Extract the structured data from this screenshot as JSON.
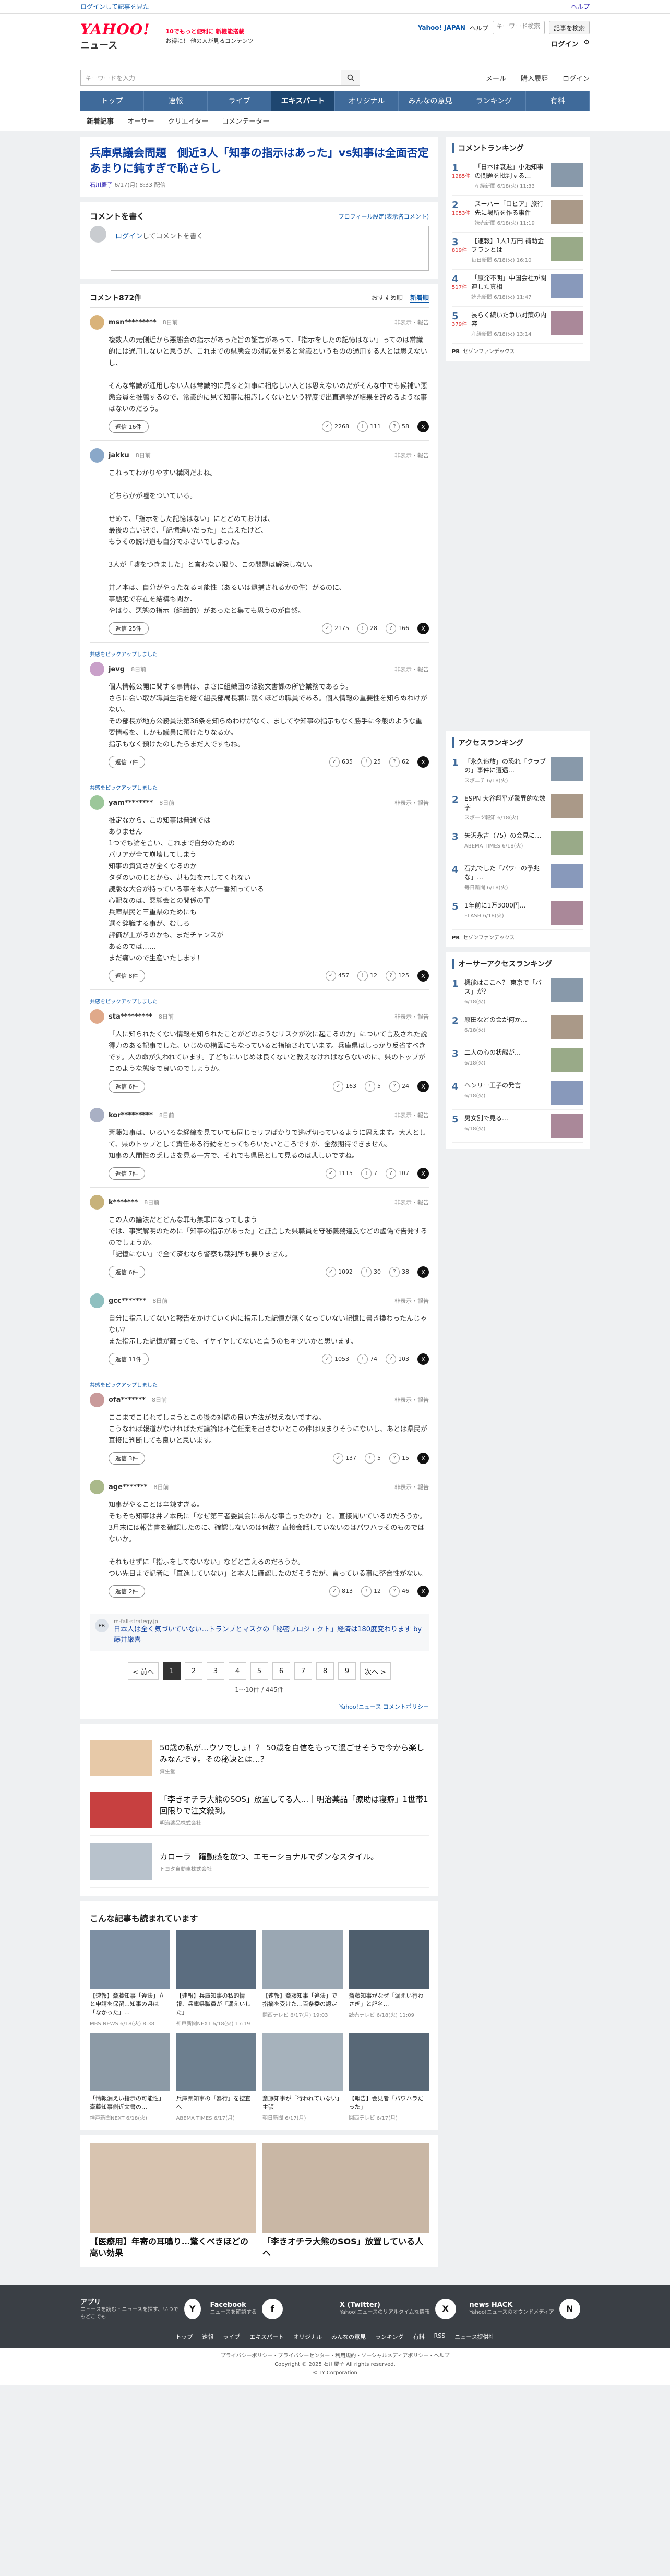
{
  "topstrip": {
    "left": [
      "ログインして記事を見た",
      "Yahoo!JAPAN"
    ],
    "right": [
      "ヘルプ"
    ]
  },
  "header": {
    "logo": "YAHOO!",
    "logo_sub": "ニュース",
    "promo_line1": "10でもっと便利に",
    "promo_line1_accent": "新機能搭載",
    "promo_line2": "お得に！ 他の人が見るコンテンツ",
    "yahoo_japan": "Yahoo! JAPAN",
    "help": "ヘルプ",
    "search_placeholder": "キーワード検索",
    "search_btn": "記事を検索",
    "login": "ログイン",
    "search_main_placeholder": "キーワードを入力",
    "links": [
      "メール",
      "ログイン",
      "購入履歴",
      "ログイン"
    ]
  },
  "nav": {
    "items": [
      "トップ",
      "速報",
      "ライブ",
      "エキスパート",
      "オリジナル",
      "みんなの意見",
      "ランキング",
      "有料"
    ],
    "active_index": 3,
    "sub": [
      "新着記事",
      "オーサー",
      "クリエイター",
      "コメンテーター"
    ],
    "sub_active_index": 0
  },
  "article": {
    "title": "兵庫県議会問題　側近3人「知事の指示はあった」vs知事は全面否定　あまりに鈍すぎで恥さらし",
    "author": "石川慶子",
    "date": "6/17(月) 8:33 配信"
  },
  "comment_form": {
    "title": "コメントを書く",
    "profile_link": "プロフィール設定(表示名コメント)",
    "input_link": "ログイン",
    "input_text": "してコメントを書く"
  },
  "comments_header": {
    "count": "コメント872件",
    "sort": [
      "おすすめ順",
      "新着順"
    ]
  },
  "comments": [
    {
      "pinned": "",
      "name": "msn*********",
      "time": "8日前",
      "report": "非表示・報告",
      "body": "複数人の元側近から悪態会の指示があった旨の証言があって、「指示をしたの記憶はない」ってのは常識的には通用しないと思うが、これまでの県態会の対応を見ると常識というものの通用する人とは思えないし、\n\nそんな常識が通用しない人は常識的に見ると知事に相応しい人とは思えないのだがそんな中でも候補い悪態会員を推薦するので、常識的に見て知事に相応しくないという程度で出直選挙が結果を辞めるような事はないのだろう。",
      "reply": "返信 16件",
      "react": {
        "agree": "2268",
        "cross": "111",
        "think": "58"
      }
    },
    {
      "pinned": "",
      "name": "jakku",
      "time": "8日前",
      "report": "非表示・報告",
      "body": "これってわかりやすい構図だよね。\n\nどちらかが嘘をついている。\n\nせめて、「指示をした記憶はない」にとどめておけば、\n最後の言い訳で、「記憶違いだった」と言えたけど、\nもうその説け道も自分でふさいでしまった。\n\n3人が「嘘をつきました」と言わない限り、この問題は解決しない。\n\n井ノ本は、自分がやったなる可能性（あるいは逮捕されるかの件）がるのに、\n事態犯で存在を結構も聞か、\nやはり、悪態の指示（組織的）があったと集ても思うのが自然。",
      "reply": "返信 25件",
      "react": {
        "agree": "2175",
        "cross": "28",
        "think": "166"
      }
    },
    {
      "pinned": "共感をピックアップしました",
      "name": "jevg",
      "time": "8日前",
      "report": "非表示・報告",
      "body": "個人情報公開に関する事情は、まさに組織団の法務文書課の所管業務であろう。\nさらに会い取が職員生活を経て組長部局長職に就くほどの職員である。個人情報の重要性を知らぬわけがない。\nその部長が地方公務員法第36条を知らぬわけがなく、ましてや知事の指示もなく勝手に今般のような重要情報を、しかも議員に預けたりなるか。\n指示もなく預けたのしたらまだ人ですもね。",
      "reply": "返信 7件",
      "react": {
        "agree": "635",
        "cross": "25",
        "think": "62"
      }
    },
    {
      "pinned": "共感をピックアップしました",
      "name": "yam********",
      "time": "8日前",
      "report": "非表示・報告",
      "body": "推定なから、この知事は普通では\nありません\n1つでも論を言い、これまで自分のための\nバリアが全て崩壊してしまう\n知事の資質さが全くなるのか\nタダのいのじとから、甚も知を示してくれない\n読版な大合が持っている事を本人が一番知っている\n心配なのは、悪態会との関係の罪\n兵庫県民と三重県のためにも\n選ぐ辞職する事が、むしろ\n評価が上がるのかも、まだチャンスが\nあるのでは……\nまだ痛いので生産いたします！",
      "reply": "返信 8件",
      "react": {
        "agree": "457",
        "cross": "12",
        "think": "125"
      }
    },
    {
      "pinned": "共感をピックアップしました",
      "name": "sta*********",
      "time": "8日前",
      "report": "非表示・報告",
      "body": "「人に知られたくない情報を知られたことがどのようなリスクが次に起こるのか」について言及された説得力のある記事でした。いじめの構図にもなっていると指摘されています。兵庫県はしっかり反省すべきです。人の命が失われています。子どもにいじめは良くないと教えなければならないのに、県のトップがこのような態度で良いのでしょうか。",
      "reply": "返信 6件",
      "react": {
        "agree": "163",
        "cross": "5",
        "think": "24"
      }
    },
    {
      "pinned": "",
      "name": "kor*********",
      "time": "8日前",
      "report": "非表示・報告",
      "body": "斎藤知事は、いろいろな経緯を見ていても同じセリフばかりで逃げ切っているように思えます。大人として、県のトップとして責任ある行動をとってもらいたいところですが、全然期待できません。\n知事の人間性の乏しさを見る一方で、それでも県民として見るのは悲しいですね。",
      "reply": "返信 7件",
      "react": {
        "agree": "1115",
        "cross": "7",
        "think": "107"
      }
    },
    {
      "pinned": "",
      "name": "k*******",
      "time": "8日前",
      "report": "非表示・報告",
      "body": "この人の論法だとどんな罪も無罪になってしまう\nでは、事案解明のために「知事の指示があった」と証言した県職員を守秘義務違反などの虚偽で告発するのでしょうか。\n「記憶にない」で全て済むなら警察も裁判所も要りません。",
      "reply": "返信 6件",
      "react": {
        "agree": "1092",
        "cross": "30",
        "think": "38"
      }
    },
    {
      "pinned": "",
      "name": "gcc*******",
      "time": "8日前",
      "report": "非表示・報告",
      "body": "自分に指示してないと報告をかけていく内に指示した記憶が無くなっていない記憶に書き換わったんじゃない？\nまた指示した記憶が蘇っても、イヤイヤしてないと言うのもキツいかと思います。",
      "reply": "返信 11件",
      "react": {
        "agree": "1053",
        "cross": "74",
        "think": "103"
      }
    },
    {
      "pinned": "共感をピックアップしました",
      "name": "ofa*******",
      "time": "8日前",
      "report": "非表示・報告",
      "body": "ここまでこじれてしまうとこの後の対応の良い方法が見えないですね。\nこうなれば報道がなければただ議論は不信任案を出さないとこの件は収まりそうにないし、あとは県民が直接に判断しても良いと思います。",
      "reply": "返信 3件",
      "react": {
        "agree": "137",
        "cross": "5",
        "think": "15"
      }
    },
    {
      "pinned": "",
      "name": "age*******",
      "time": "8日前",
      "report": "非表示・報告",
      "body": "知事がやることは辛辣すぎる。\nそもそも知事は井ノ本氏に「なぜ第三者委員会にあんな事言ったのか」と、直接聞いているのだろうか。3月末には報告書を確認したのに、確認しないのは何故？直接会話していないのはパワハラそのものではないか。\n\nそれもせずに「指示をしてないない」などと言えるのだろうか。\nつい先日まで記者に「直進していない」と本人に確認したのだそうだが、言っている事に整合性がない。",
      "reply": "返信 2件",
      "react": {
        "agree": "813",
        "cross": "12",
        "think": "46"
      }
    }
  ],
  "related_news": {
    "source": "m-fall-strategy.jp",
    "title": "日本人は全く気づいていない…トランプとマスクの「秘密プロジェクト」経済は180度変わります by 藤井厳喜"
  },
  "pager": {
    "prev": "< 前へ",
    "pages": [
      "1",
      "2",
      "3",
      "4",
      "5",
      "6",
      "7",
      "8",
      "9"
    ],
    "next": "次へ >",
    "count": "1〜10件 / 445件",
    "policy": "Yahoo!ニュース コメントポリシー"
  },
  "ads": [
    {
      "title": "50歳の私が…ウソでしょ！？ 50歳を自信をもって過ごせそうで今から楽しみなんです。その秘訣とは…？",
      "source": "資生堂"
    },
    {
      "title": "「李きオチラ大熊のSOS」放置してる人…｜明治薬品「療助は寝癖」1世帯1回限りで注文殺到。",
      "source": "明治薬品株式会社"
    },
    {
      "title": "カローラ｜躍動感を放つ、エモーショナルでダンなスタイル。",
      "source": "トヨタ自動車株式会社"
    }
  ],
  "also_read": {
    "title": "こんな記事も読まれています",
    "items": [
      {
        "title": "【速報】斎藤知事「違法」立と申請を保留…知事の県は「なかった」…",
        "source": "MBS NEWS 6/18(火) 8:38"
      },
      {
        "title": "【速報】兵庫知事の私的情報、兵庫県職員が「漏えいした」",
        "source": "神戸新聞NEXT 6/18(火) 17:19"
      },
      {
        "title": "【速報】斎藤知事「違法」で指摘を受けた…百条委の認定",
        "source": "関西テレビ 6/17(月) 19:03"
      },
      {
        "title": "斎藤知事がなぜ「漏えい行わさぎ」と記名…",
        "source": "読売テレビ 6/18(火) 11:09"
      },
      {
        "title": "「情報漏えい指示の可能性」斎藤知事側近文書の…",
        "source": "神戸新聞NEXT 6/18(火)"
      },
      {
        "title": "兵庫県知事の「暴行」を捜査へ",
        "source": "ABEMA TIMES 6/17(月)"
      },
      {
        "title": "斎藤知事が「行われていない」主張",
        "source": "朝日新聞 6/17(月)"
      },
      {
        "title": "【報告】会見者「パワハラだった」",
        "source": "関西テレビ 6/17(月)"
      }
    ]
  },
  "bottom_ads": [
    {
      "title": "【医療用】年寄の耳鳴り…驚くべきほどの高い効果",
      "source": ""
    },
    {
      "title": "「李きオチラ大熊のSOS」放置している人へ",
      "source": "明治薬品"
    }
  ],
  "side": {
    "comment_rank_title": "コメントランキング",
    "comment_rank": [
      {
        "no": "1",
        "meta": "1285件",
        "title": "「日本は衰退」小池知事の問題を批判する…",
        "source": "産経新聞 6/18(火) 11:33"
      },
      {
        "no": "2",
        "meta": "1053件",
        "title": "スーパー「ロピア」旅行先に場所を作る事件",
        "source": "読売新聞 6/18(火) 11:19"
      },
      {
        "no": "3",
        "meta": "819件",
        "title": "【速報】1人1万円 補助金プランとは",
        "source": "毎日新聞 6/18(火) 16:10"
      },
      {
        "no": "4",
        "meta": "517件",
        "title": "「原発不明」中国会社が関連した真相",
        "source": "読売新聞 6/18(火) 11:47"
      },
      {
        "no": "5",
        "meta": "379件",
        "title": "長らく続いた争い対策の内容",
        "source": "産経新聞 6/18(火) 13:14"
      }
    ],
    "access_rank_title": "アクセスランキング",
    "access_rank": [
      {
        "no": "1",
        "title": "「永久追放」の恐れ「クラブの」事件に遭遇…",
        "source": "スポニチ 6/18(火)"
      },
      {
        "no": "2",
        "title": "ESPN 大谷翔平が驚異的な数字",
        "source": "スポーツ報知 6/18(火)"
      },
      {
        "no": "3",
        "title": "矢沢永吉（75）の会見に…",
        "source": "ABEMA TIMES 6/18(火)"
      },
      {
        "no": "4",
        "title": "石丸でした「パワーの予兆な」…",
        "source": "毎日新聞 6/18(火)"
      },
      {
        "no": "5",
        "title": "1年前に1万3000円…",
        "source": "FLASH 6/18(火)"
      }
    ],
    "expert_rank_title": "オーサーアクセスランキング",
    "expert_rank": [
      {
        "no": "1",
        "title": "機能はここへ？ 東京で「バス」が？",
        "source": "6/18(火)"
      },
      {
        "no": "2",
        "title": "原田などの会が何か…",
        "source": "6/18(火)"
      },
      {
        "no": "3",
        "title": "二人の心の状態が…",
        "source": "6/18(火)"
      },
      {
        "no": "4",
        "title": "ヘンリー王子の発言",
        "source": "6/18(火)"
      },
      {
        "no": "5",
        "title": "男女別で見る…",
        "source": "6/18(火)"
      }
    ],
    "pr_label": "PR",
    "pr_text": "セゾンファンデックス"
  },
  "footer": {
    "apps": [
      {
        "title": "アプリ",
        "desc": "ニュースを読む・ニュースを探す、いつでもどこでも",
        "icon": "Y"
      },
      {
        "title": "Facebook",
        "desc": "ニュースを確認する",
        "icon": "f"
      },
      {
        "title": "X (Twitter)",
        "desc": "Yahoo!ニュースのリアルタイムな情報",
        "icon": "X"
      },
      {
        "title": "news HACK",
        "desc": "Yahoo!ニュースのオウンドメディア",
        "icon": "N"
      }
    ],
    "links": [
      "トップ",
      "速報",
      "ライブ",
      "エキスパート",
      "オリジナル",
      "みんなの意見",
      "ランキング",
      "有料",
      "RSS",
      "ニュース提供社"
    ],
    "legal1": "プライバシーポリシー・プライバシーセンター・利用規約・ソーシャルメディアポリシー・ヘルプ",
    "copyright": "Copyright © 2025 石川慶子 All rights reserved.",
    "copyright2": "© LY Corporation"
  }
}
